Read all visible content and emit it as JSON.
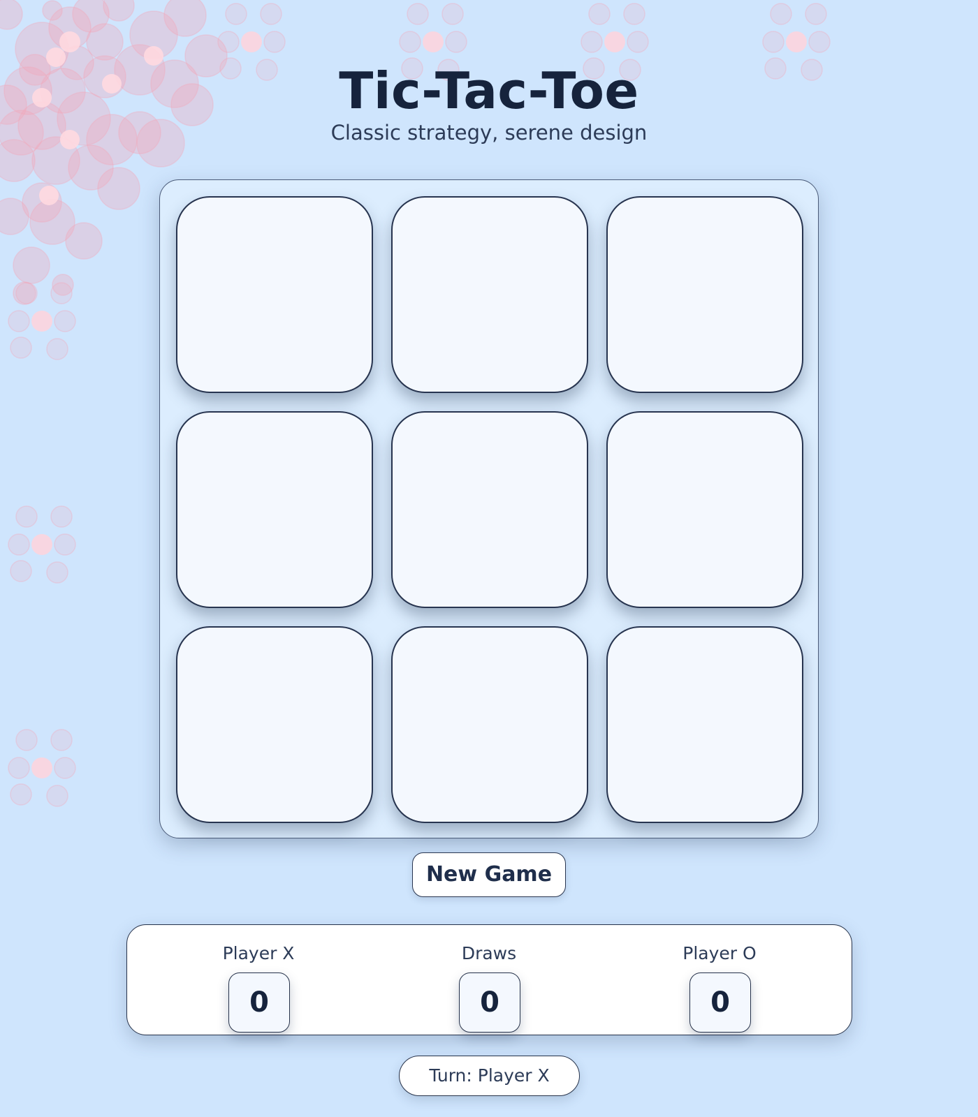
{
  "header": {
    "title": "Tic-Tac-Toe",
    "subtitle": "Classic strategy, serene design"
  },
  "board": {
    "cells": [
      "",
      "",
      "",
      "",
      "",
      "",
      "",
      "",
      ""
    ]
  },
  "controls": {
    "new_game_label": "New Game"
  },
  "scoreboard": {
    "player_x": {
      "label": "Player X",
      "value": "0"
    },
    "draws": {
      "label": "Draws",
      "value": "0"
    },
    "player_o": {
      "label": "Player O",
      "value": "0"
    }
  },
  "status": {
    "turn_text": "Turn: Player X"
  },
  "colors": {
    "background": "#cfe5fd",
    "board": "#dcedfe",
    "cell": "#f4f8fe",
    "border": "#27344f",
    "bubble": "#f3a5b8"
  }
}
